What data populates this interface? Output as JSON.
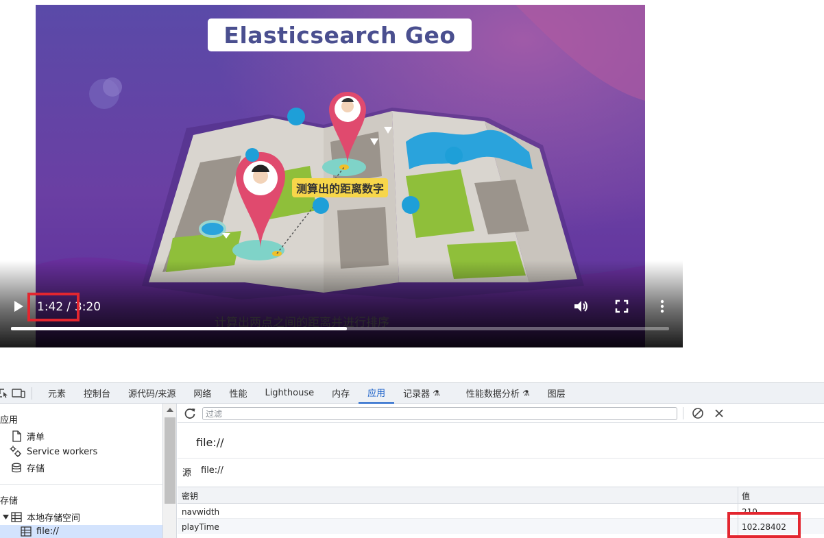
{
  "video": {
    "title_card": "Elasticsearch Geo",
    "map_label": "测算出的距离数字",
    "subtitle": "计算出两点之间的距离并进行排序",
    "current_time": "1:42",
    "separator": "/",
    "duration": "3:20",
    "progress_fraction": 0.51,
    "icons": [
      "play-icon",
      "volume-icon",
      "fullscreen-icon",
      "more-vert-icon"
    ]
  },
  "devtools": {
    "tabs": [
      {
        "label": "元素"
      },
      {
        "label": "控制台"
      },
      {
        "label": "源代码/来源"
      },
      {
        "label": "网络"
      },
      {
        "label": "性能"
      },
      {
        "label": "Lighthouse"
      },
      {
        "label": "内存"
      },
      {
        "label": "应用",
        "active": true
      },
      {
        "label": "记录器"
      },
      {
        "label": "性能数据分析"
      },
      {
        "label": "图层"
      }
    ],
    "sidebar": {
      "app_heading": "应用",
      "app_items": [
        {
          "label": "清单",
          "icon": "file-icon"
        },
        {
          "label": "Service workers",
          "icon": "gears-icon"
        },
        {
          "label": "存储",
          "icon": "database-icon"
        }
      ],
      "storage_heading": "存储",
      "storage_items": [
        {
          "label": "本地存储空间",
          "icon": "table-icon",
          "expanded": true
        },
        {
          "label": "file://",
          "icon": "table-icon",
          "selected": true
        }
      ]
    },
    "toolbar": {
      "filter_placeholder": "过滤"
    },
    "origin_header": "file://",
    "origin_label": "源",
    "origin_value": "file://",
    "table": {
      "columns": [
        "密钥",
        "值"
      ],
      "rows": [
        {
          "key": "navwidth",
          "value": "210"
        },
        {
          "key": "playTime",
          "value": "102.28402"
        }
      ]
    },
    "colors": {
      "accent": "#1a60c9",
      "highlight": "#e3262f",
      "selected": "#d3e3fd"
    }
  }
}
